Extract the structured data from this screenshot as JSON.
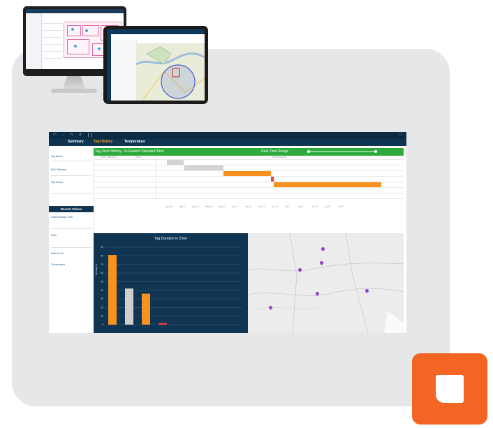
{
  "app": {
    "tabs": [
      "Summary",
      "Tag History",
      "Temperature"
    ],
    "active_tab": "Tag History",
    "left_panel": {
      "fields": [
        "Tag Name",
        "MAC Address",
        "Tag Group"
      ],
      "recent_header": "Recent Values",
      "recent_fields": [
        "Last Message Time",
        "Zone",
        "Battery Life",
        "Temperature"
      ]
    },
    "gantt": {
      "title": "Tag Zone History · In Eastern Standard Time",
      "range_label": "Data Time Range",
      "col1": "Zone Category",
      "col2": "Zone",
      "col3": "Zone Duration",
      "ticks": [
        "Apr 29",
        "May 6",
        "May 13",
        "May 20",
        "May 27",
        "Jun 3",
        "Jun 10",
        "Jun 17",
        "Jun 24",
        "Jul 1",
        "Jul 8",
        "Jul 15",
        "Jul 22",
        "Jul 29"
      ]
    },
    "chart": {
      "title": "Tag Duration in Zone",
      "ylabel": "Average of",
      "colors": [
        "#f7921e",
        "#cfcfcf",
        "#f7921e",
        "#e2413a"
      ]
    }
  },
  "chart_data": {
    "type": "bar",
    "title": "Tag Duration in Zone",
    "ylabel": "",
    "ylim": [
      0,
      90
    ],
    "yticks": [
      0,
      10,
      20,
      30,
      40,
      50,
      60,
      70,
      80,
      90
    ],
    "categories": [
      "",
      "",
      "",
      ""
    ],
    "values": [
      81,
      42,
      36,
      2
    ]
  }
}
